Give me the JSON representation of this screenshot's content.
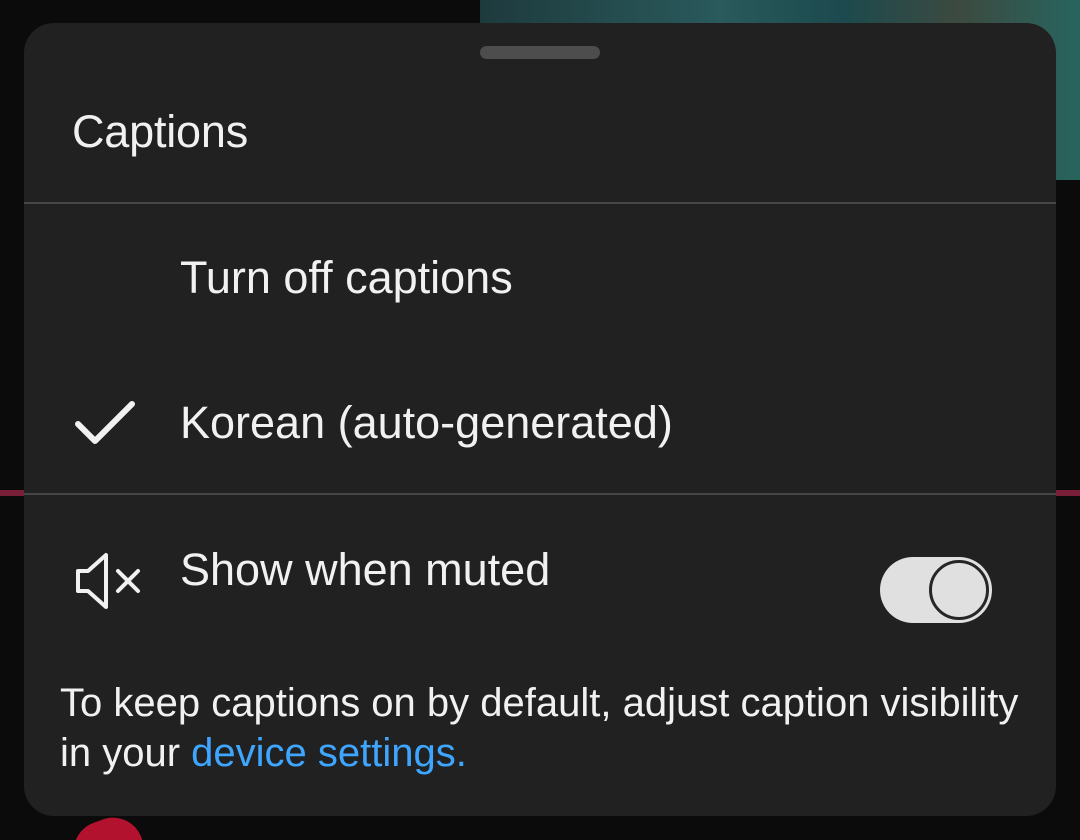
{
  "sheet": {
    "title": "Captions"
  },
  "options": [
    {
      "label": "Turn off captions",
      "selected": false
    },
    {
      "label": "Korean (auto-generated)",
      "selected": true
    }
  ],
  "show_when_muted": {
    "label": "Show when muted",
    "icon": "volume-muted-icon",
    "enabled": true
  },
  "note": {
    "text": "To keep captions on by default, adjust caption visibility in your ",
    "link_text": "device settings."
  },
  "colors": {
    "sheet_bg": "#212121",
    "text": "#f1f1f1",
    "link": "#3ea6ff",
    "toggle_track": "#e0e0e0",
    "divider": "#474747"
  }
}
